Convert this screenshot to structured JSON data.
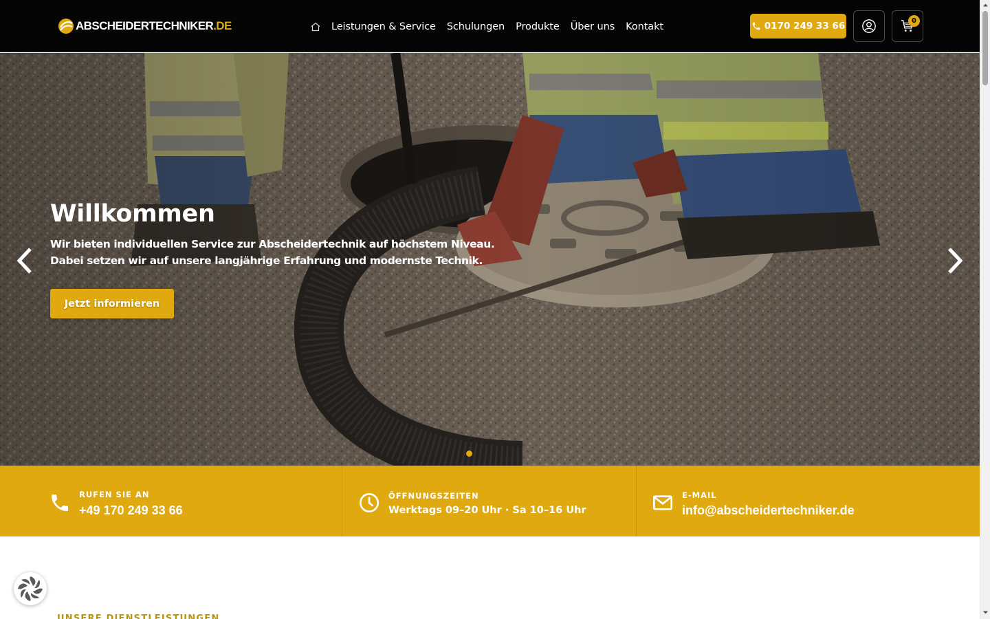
{
  "header": {
    "logo_text": "ABSCHEIDERTECHNIKER",
    "logo_tld": ".DE",
    "nav_home_icon": "home-icon",
    "nav": [
      {
        "label": "Leistungen & Service"
      },
      {
        "label": "Schulungen"
      },
      {
        "label": "Produkte"
      },
      {
        "label": "Über uns"
      },
      {
        "label": "Kontakt"
      }
    ],
    "phone_label": "0170 249 33 66",
    "phone_icon": "phone-icon",
    "account_icon": "user-icon",
    "cart_icon": "cart-icon",
    "cart_count": "0"
  },
  "hero": {
    "title": "Willkommen",
    "text_line1": "Wir bieten individuellen Service zur Abscheidertechnik auf höchstem Niveau.",
    "text_line2": "Dabei setzen wir auf unsere langjährige Erfahrung und modernste Technik.",
    "cta_label": "Jetzt informieren",
    "prev_icon": "chevron-left-icon",
    "next_icon": "chevron-right-icon",
    "slide_count": 1,
    "active_slide": 1
  },
  "infobar": {
    "call_label": "RUFEN SIE AN",
    "call_value": "+49 170 249 33 66",
    "hours_label": "ÖFFNUNGSZEITEN",
    "hours_value": "Werktags 09–20 Uhr · Sa 10–16 Uhr",
    "email_label": "E-MAIL",
    "email_value": "info@abscheidertechniker.de"
  },
  "section": {
    "label": "UNSERE DIENSTLEISTUNGEN"
  },
  "colors": {
    "accent": "#e0a90f",
    "header_bg": "#050505",
    "text_on_accent": "#ffffff"
  }
}
